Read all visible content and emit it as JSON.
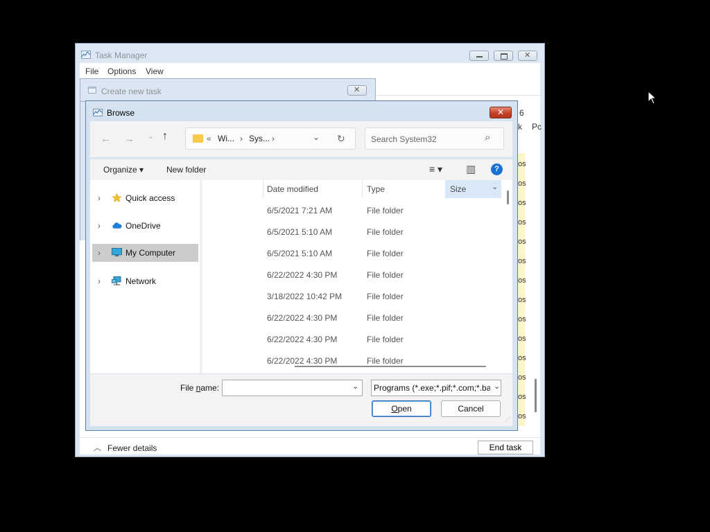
{
  "task_manager": {
    "title": "Task Manager",
    "menu": [
      "File",
      "Options",
      "View"
    ],
    "column_fragments": [
      "6",
      "k",
      "Pc"
    ],
    "row_fragment": "os",
    "fewer_details": "Fewer details",
    "end_task": "End task"
  },
  "create_task": {
    "title": "Create new task"
  },
  "browse": {
    "title": "Browse",
    "close_glyph": "✕",
    "nav": {
      "back": "←",
      "forward": "→",
      "recent": "⌄",
      "up": "↑",
      "address_prefix": "«",
      "crumbs": [
        "Wi...",
        "Sys..."
      ],
      "crumb_sep": "›",
      "address_dropdown": "⌄",
      "refresh": "↻"
    },
    "search": {
      "placeholder": "Search System32",
      "icon": "⌕"
    },
    "commands": {
      "organize": "Organize ▾",
      "new_folder": "New folder",
      "view_icon": "≡ ▾",
      "pane_icon": "▥",
      "help": "?"
    },
    "nav_pane": [
      {
        "label": "Quick access",
        "icon": "star-icon"
      },
      {
        "label": "OneDrive",
        "icon": "cloud-icon"
      },
      {
        "label": "My Computer",
        "icon": "computer-icon",
        "selected": true
      },
      {
        "label": "Network",
        "icon": "network-icon"
      }
    ],
    "columns": {
      "date": "Date modified",
      "type": "Type",
      "size": "Size",
      "size_chevron": "⌄"
    },
    "rows": [
      {
        "date": "6/5/2021 7:21 AM",
        "type": "File folder"
      },
      {
        "date": "6/5/2021 5:10 AM",
        "type": "File folder"
      },
      {
        "date": "6/5/2021 5:10 AM",
        "type": "File folder"
      },
      {
        "date": "6/22/2022 4:30 PM",
        "type": "File folder"
      },
      {
        "date": "3/18/2022 10:42 PM",
        "type": "File folder"
      },
      {
        "date": "6/22/2022 4:30 PM",
        "type": "File folder"
      },
      {
        "date": "6/22/2022 4:30 PM",
        "type": "File folder"
      },
      {
        "date": "6/22/2022 4:30 PM",
        "type": "File folder"
      }
    ],
    "footer": {
      "file_name_label_pre": "File ",
      "file_name_label_u": "n",
      "file_name_label_post": "ame:",
      "file_name_value": "",
      "dropdown_arrow": "⌄",
      "file_type": "Programs (*.exe;*.pif;*.com;*.bat;*.cmd)",
      "open_u": "O",
      "open_rest": "pen",
      "cancel": "Cancel"
    }
  },
  "colors": {
    "accent_blue": "#0067c0",
    "selection_gray": "#cccccc",
    "size_header_bg": "#d9e8f6",
    "close_red": "#c4412a"
  }
}
